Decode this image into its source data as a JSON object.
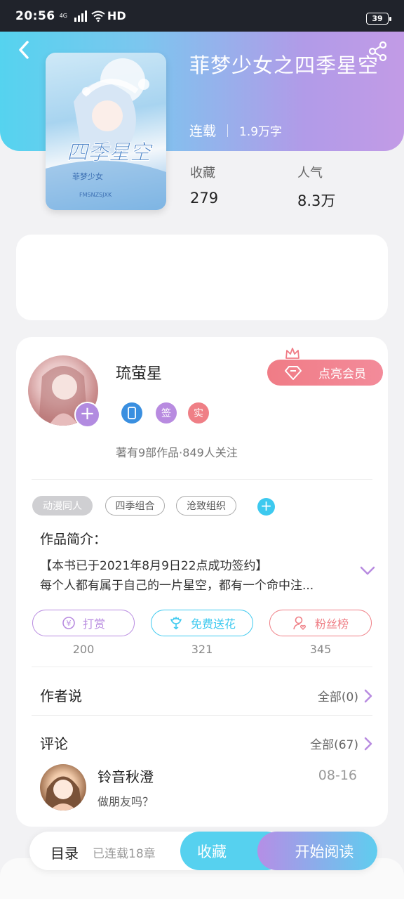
{
  "status_bar": {
    "time": "20:56",
    "network": "4G",
    "hd": "HD",
    "battery": "39"
  },
  "book": {
    "title": "菲梦少女之四季星空",
    "status": "连载",
    "word_count": "1.9万字",
    "cover_text_main": "四季星空",
    "cover_text_sub": "菲梦少女",
    "cover_text_small": "FMSNZSJXK"
  },
  "stats": {
    "favorites_label": "收藏",
    "favorites_value": "279",
    "popularity_label": "人气",
    "popularity_value": "8.3万"
  },
  "author": {
    "name": "琉萤星",
    "vip_label": "点亮会员",
    "badges": [
      {
        "label": "",
        "color": "#3a8fe0"
      },
      {
        "label": "签",
        "color": "#b88be0"
      },
      {
        "label": "实",
        "color": "#ef7f86"
      }
    ],
    "summary": "著有9部作品·849人关注"
  },
  "tags": [
    "动漫同人",
    "四季组合",
    "沧致组织"
  ],
  "intro": {
    "title": "作品简介：",
    "line1": "【本书已于2021年8月9日22点成功签约】",
    "line2": "每个人都有属于自己的一片星空，都有一个命中注..."
  },
  "actions": [
    {
      "label": "打赏",
      "count": "200",
      "color": "#b88be0"
    },
    {
      "label": "免费送花",
      "count": "321",
      "color": "#3dc9ef"
    },
    {
      "label": "粉丝榜",
      "count": "345",
      "color": "#ef7f86"
    }
  ],
  "author_says": {
    "title": "作者说",
    "link": "全部(0)"
  },
  "comments": {
    "title": "评论",
    "link": "全部(67)",
    "items": [
      {
        "user": "铃音秋澄",
        "date": "08-16",
        "text": "做朋友吗？"
      }
    ]
  },
  "bottom_bar": {
    "toc": "目录",
    "chapters": "已连载18章",
    "favorite": "收藏",
    "read": "开始阅读"
  }
}
